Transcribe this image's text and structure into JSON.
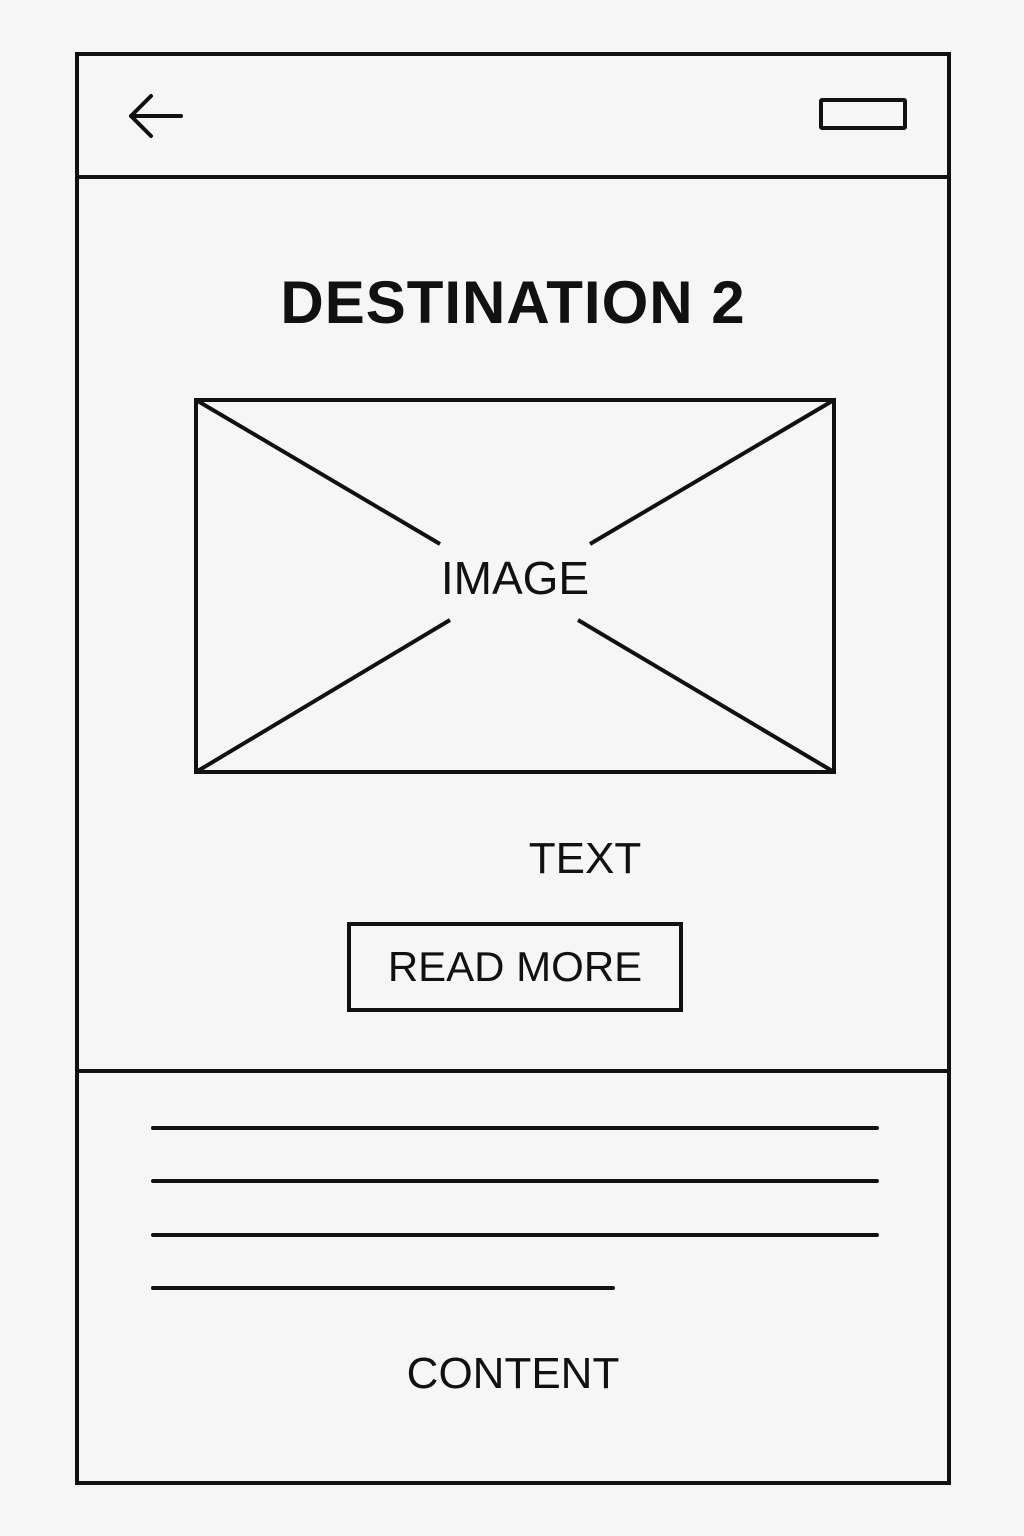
{
  "header": {
    "back_icon": "arrow-left-icon",
    "menu_icon": "rectangle-button-icon"
  },
  "main": {
    "title": "DESTINATION 2",
    "image_placeholder_label": "IMAGE",
    "text_label": "TEXT",
    "read_more_label": "READ MORE"
  },
  "content_section": {
    "text_lines": 4,
    "label": "CONTENT"
  }
}
